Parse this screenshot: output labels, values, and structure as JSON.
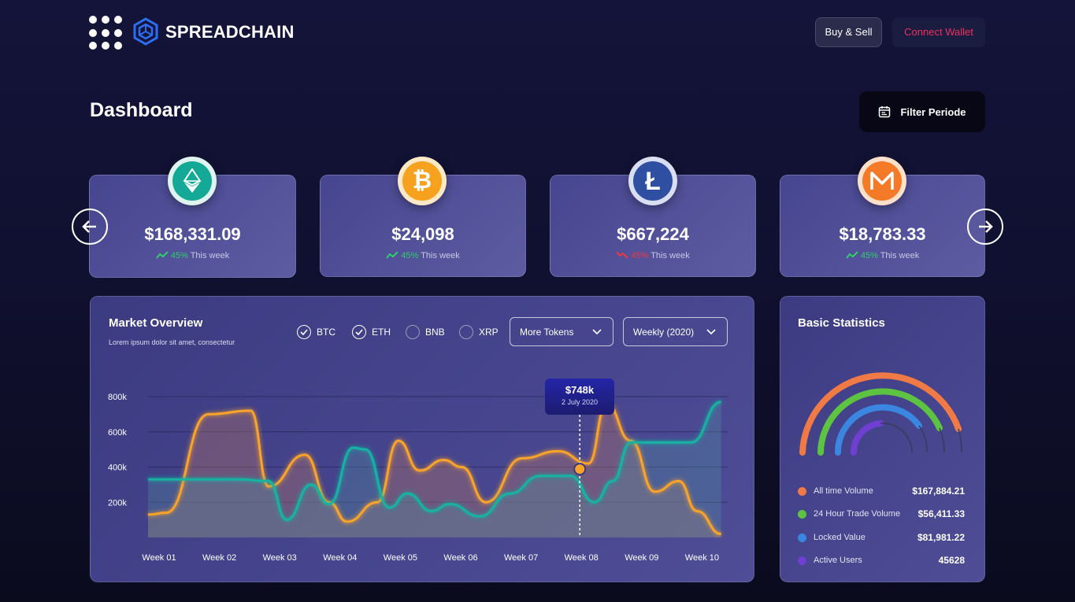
{
  "header": {
    "brand": "SPREADCHAIN",
    "buy_sell_label": "Buy & Sell",
    "connect_wallet_label": "Connect Wallet"
  },
  "page": {
    "title": "Dashboard",
    "filter_label": "Filter Periode"
  },
  "coins": [
    {
      "symbol": "ETH",
      "icon": "ethereum-icon",
      "color": "#13a996",
      "price": "$168,331.09",
      "pct": "45%",
      "trend": "up",
      "period": "This week"
    },
    {
      "symbol": "BTC",
      "icon": "bitcoin-icon",
      "color": "#f6a21e",
      "price": "$24,098",
      "pct": "45%",
      "trend": "up",
      "period": "This week"
    },
    {
      "symbol": "LTC",
      "icon": "litecoin-icon",
      "color": "#2f4fa2",
      "price": "$667,224",
      "pct": "45%",
      "trend": "down",
      "period": "This week"
    },
    {
      "symbol": "XMR",
      "icon": "monero-icon",
      "color": "#f47a27",
      "price": "$18,783.33",
      "pct": "45%",
      "trend": "up",
      "period": "This week"
    }
  ],
  "market": {
    "title": "Market Overview",
    "subtitle": "Lorem ipsum dolor sit amet, consectetur",
    "tokens": [
      {
        "label": "BTC",
        "checked": true
      },
      {
        "label": "ETH",
        "checked": true
      },
      {
        "label": "BNB",
        "checked": false
      },
      {
        "label": "XRP",
        "checked": false
      }
    ],
    "more_tokens_label": "More Tokens",
    "period_label": "Weekly (2020)",
    "tooltip": {
      "value": "$748k",
      "date": "2 July 2020"
    }
  },
  "chart_data": {
    "type": "line",
    "categories": [
      "Week 01",
      "Week 02",
      "Week 03",
      "Week 04",
      "Week 05",
      "Week 06",
      "Week 07",
      "Week 08",
      "Week 09",
      "Week 10"
    ],
    "y_ticks": [
      "800k",
      "600k",
      "400k",
      "200k"
    ],
    "ylim": [
      0,
      800000
    ],
    "series": [
      {
        "name": "BTC",
        "color": "#f9a32a",
        "x": [
          0,
          0.3,
          1,
          1.7,
          2,
          2.6,
          3,
          3.3,
          3.8,
          4.15,
          4.5,
          4.9,
          5.2,
          5.6,
          6.2,
          6.8,
          7.3,
          7.6,
          8,
          8.4,
          8.8,
          9.1,
          9.5
        ],
        "values": [
          130000,
          140000,
          700000,
          720000,
          290000,
          470000,
          200000,
          90000,
          200000,
          550000,
          380000,
          440000,
          400000,
          200000,
          450000,
          490000,
          420000,
          760000,
          550000,
          260000,
          320000,
          150000,
          20000
        ]
      },
      {
        "name": "ETH",
        "color": "#13b3a2",
        "x": [
          0,
          0.6,
          1.5,
          2,
          2.3,
          2.7,
          3,
          3.4,
          3.6,
          4,
          4.3,
          4.7,
          5,
          5.5,
          6,
          6.5,
          7,
          7.4,
          7.7,
          8,
          8.5,
          9,
          9.5
        ],
        "values": [
          330000,
          330000,
          330000,
          320000,
          100000,
          300000,
          190000,
          510000,
          500000,
          170000,
          250000,
          150000,
          190000,
          120000,
          250000,
          350000,
          350000,
          200000,
          320000,
          540000,
          540000,
          540000,
          770000
        ]
      }
    ],
    "marker": {
      "category": "Week 08",
      "value": 500000,
      "label": "$748k",
      "date": "2 July 2020"
    }
  },
  "stats": {
    "title": "Basic Statistics",
    "items": [
      {
        "label": "All time Volume",
        "value": "$167,884.21",
        "color": "#ef7a45"
      },
      {
        "label": "24 Hour Trade Volume",
        "value": "$56,411.33",
        "color": "#5cc441"
      },
      {
        "label": "Locked Value",
        "value": "$81,981.22",
        "color": "#3a86e0"
      },
      {
        "label": "Active Users",
        "value": "45628",
        "color": "#6f3fd2"
      }
    ]
  }
}
